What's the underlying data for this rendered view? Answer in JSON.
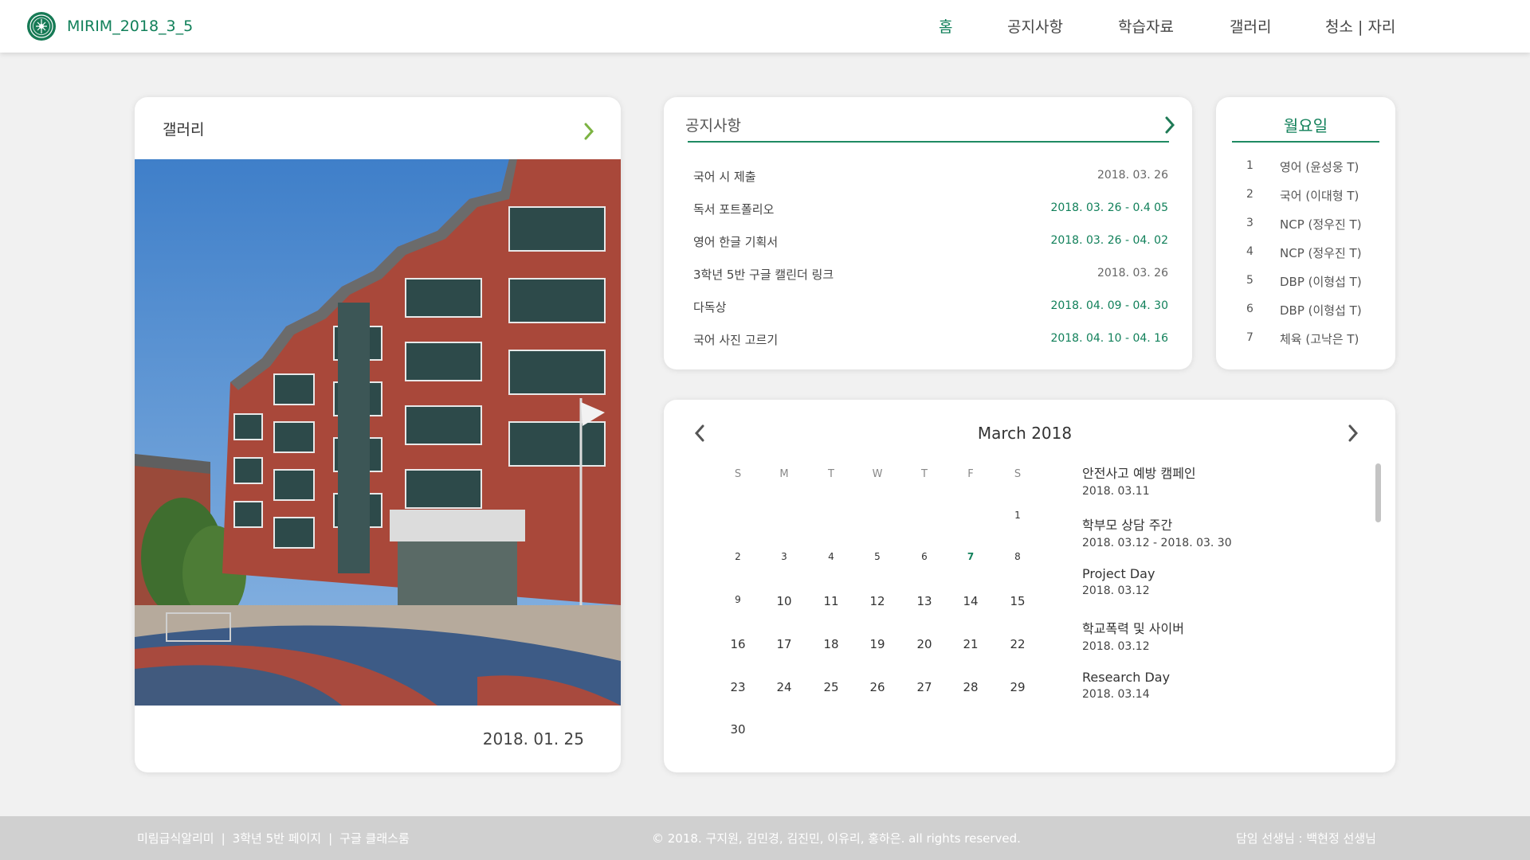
{
  "header": {
    "site_title": "MIRIM_2018_3_5",
    "nav": [
      {
        "label": "홈",
        "active": true
      },
      {
        "label": "공지사항",
        "active": false
      },
      {
        "label": "학습자료",
        "active": false
      },
      {
        "label": "갤러리",
        "active": false
      },
      {
        "label": "청소 | 자리",
        "active": false
      }
    ]
  },
  "gallery": {
    "title": "갤러리",
    "photo_date": "2018. 01. 25"
  },
  "notice": {
    "title": "공지사항",
    "items": [
      {
        "title": "국어 시 제출",
        "date": "2018. 03. 26",
        "highlight": false
      },
      {
        "title": "독서 포트폴리오",
        "date": "2018. 03. 26 - 0.4 05",
        "highlight": true
      },
      {
        "title": "영어 한글 기획서",
        "date": "2018. 03. 26 - 04. 02",
        "highlight": true
      },
      {
        "title": "3학년 5반 구글 캘린더 링크",
        "date": "2018. 03. 26",
        "highlight": false
      },
      {
        "title": "다독상",
        "date": "2018. 04. 09 - 04. 30",
        "highlight": true
      },
      {
        "title": "국어 사진 고르기",
        "date": "2018. 04. 10 - 04. 16",
        "highlight": true
      }
    ]
  },
  "schedule": {
    "title": "월요일",
    "periods": [
      {
        "num": "1",
        "subject": "영어 (윤성웅 T)"
      },
      {
        "num": "2",
        "subject": "국어 (이대형 T)"
      },
      {
        "num": "3",
        "subject": "NCP (정우진 T)"
      },
      {
        "num": "4",
        "subject": "NCP (정우진 T)"
      },
      {
        "num": "5",
        "subject": "DBP (이형섭 T)"
      },
      {
        "num": "6",
        "subject": "DBP (이형섭 T)"
      },
      {
        "num": "7",
        "subject": "체육 (고낙은 T)"
      }
    ]
  },
  "calendar": {
    "month_label": "March 2018",
    "weekdays": [
      "S",
      "M",
      "T",
      "W",
      "T",
      "F",
      "S"
    ],
    "weeks": [
      [
        "",
        "",
        "",
        "",
        "",
        "",
        "1"
      ],
      [
        "2",
        "3",
        "4",
        "5",
        "6",
        "7",
        "8"
      ],
      [
        "9",
        "10",
        "11",
        "12",
        "13",
        "14",
        "15"
      ],
      [
        "16",
        "17",
        "18",
        "19",
        "20",
        "21",
        "22"
      ],
      [
        "23",
        "24",
        "25",
        "26",
        "27",
        "28",
        "29"
      ],
      [
        "30",
        "",
        "",
        "",
        "",
        "",
        ""
      ]
    ],
    "today": "7",
    "events": [
      {
        "title": "안전사고 예방 캠페인",
        "date": "2018. 03.11"
      },
      {
        "title": "학부모 상담 주간",
        "date": " 2018. 03.12 - 2018. 03. 30"
      },
      {
        "title": "Project Day",
        "date": "2018. 03.12"
      },
      {
        "title": "학교폭력 및 사이버",
        "date": "2018. 03.12"
      },
      {
        "title": "Research Day",
        "date": "2018. 03.14"
      }
    ]
  },
  "footer": {
    "link_1": "미림급식알리미",
    "link_2": "3학년 5반 페이지",
    "link_3": "구글 클래스룸",
    "separator": "|",
    "copyright": "© 2018. 구지원, 김민경, 김진민, 이유리, 홍하은. all rights reserved.",
    "teacher": "담임 선생님 : 백현정 선생님"
  },
  "colors": {
    "accent": "#11805a",
    "background": "#f1f1f1",
    "footer": "#d0d0d0"
  },
  "icons": {
    "logo": "school-emblem-icon",
    "more": "chevron-right-icon",
    "prev": "chevron-left-icon"
  }
}
